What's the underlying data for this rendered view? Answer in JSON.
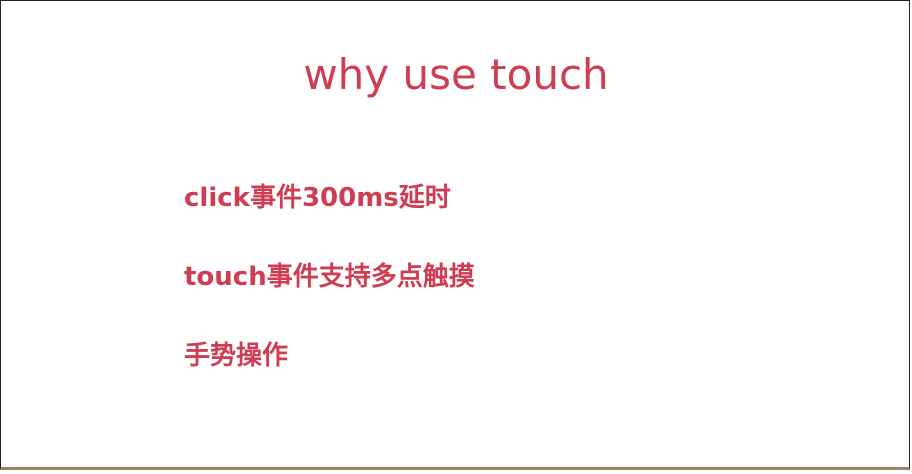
{
  "slide": {
    "title": "why use touch",
    "points": [
      "click事件300ms延时",
      "touch事件支持多点触摸",
      "手势操作"
    ]
  },
  "colors": {
    "accent": "#d03c52",
    "background": "#ffffff",
    "bottom_border": "#a08060"
  }
}
